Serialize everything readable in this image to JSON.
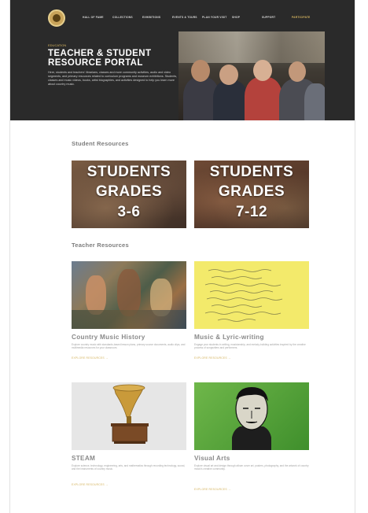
{
  "nav": {
    "items": [
      {
        "label": "Hall of Fame"
      },
      {
        "label": "Collections"
      },
      {
        "label": "Exhibitions"
      },
      {
        "label": "Events & Tours"
      },
      {
        "label": "Plan Your Visit"
      },
      {
        "label": "Shop"
      },
      {
        "label": "Support"
      },
      {
        "label": "Participate"
      }
    ],
    "active_index": 7
  },
  "hero": {
    "kicker": "Education",
    "title": "TEACHER & STUDENT RESOURCE PORTAL",
    "description": "Here, students and teachers' librarians, classes and more community activities, audio and video segments, and primary resources related to curriculum programs and museum exhibitions. Students, classes and music videos, books, artist biographies, and activities designed to help you learn more about country music."
  },
  "student_section": {
    "title": "Student Resources",
    "cards": [
      {
        "line1": "STUDENTS",
        "line2": "GRADES",
        "line3": "3-6"
      },
      {
        "line1": "STUDENTS",
        "line2": "GRADES",
        "line3": "7-12"
      }
    ]
  },
  "teacher_section": {
    "title": "Teacher Resources",
    "cards": [
      {
        "title": "Country Music History",
        "description": "Explore country music with standards-based lesson plans, primary source documents, audio clips, and multimedia resources for your classroom.",
        "link": "Explore Resources →"
      },
      {
        "title": "Music & Lyric-writing",
        "description": "Engage your students in writing, musicianship, and melody-building activities inspired by the creative process of songwriters and performers.",
        "link": "Explore Resources →"
      },
      {
        "title": "STEAM",
        "description": "Explore science, technology, engineering, arts, and mathematics through recording technology, sound, and the instruments of country music.",
        "link": "Explore Resources →"
      },
      {
        "title": "Visual Arts",
        "description": "Explore visual art and design through album cover art, posters, photography, and the artwork of country music's creative community.",
        "link": "Explore Resources →"
      }
    ]
  },
  "colors": {
    "hero_bg": "#2a2a2a",
    "accent_gold": "#d4b35e",
    "heading_gray": "#7d7d7d"
  }
}
